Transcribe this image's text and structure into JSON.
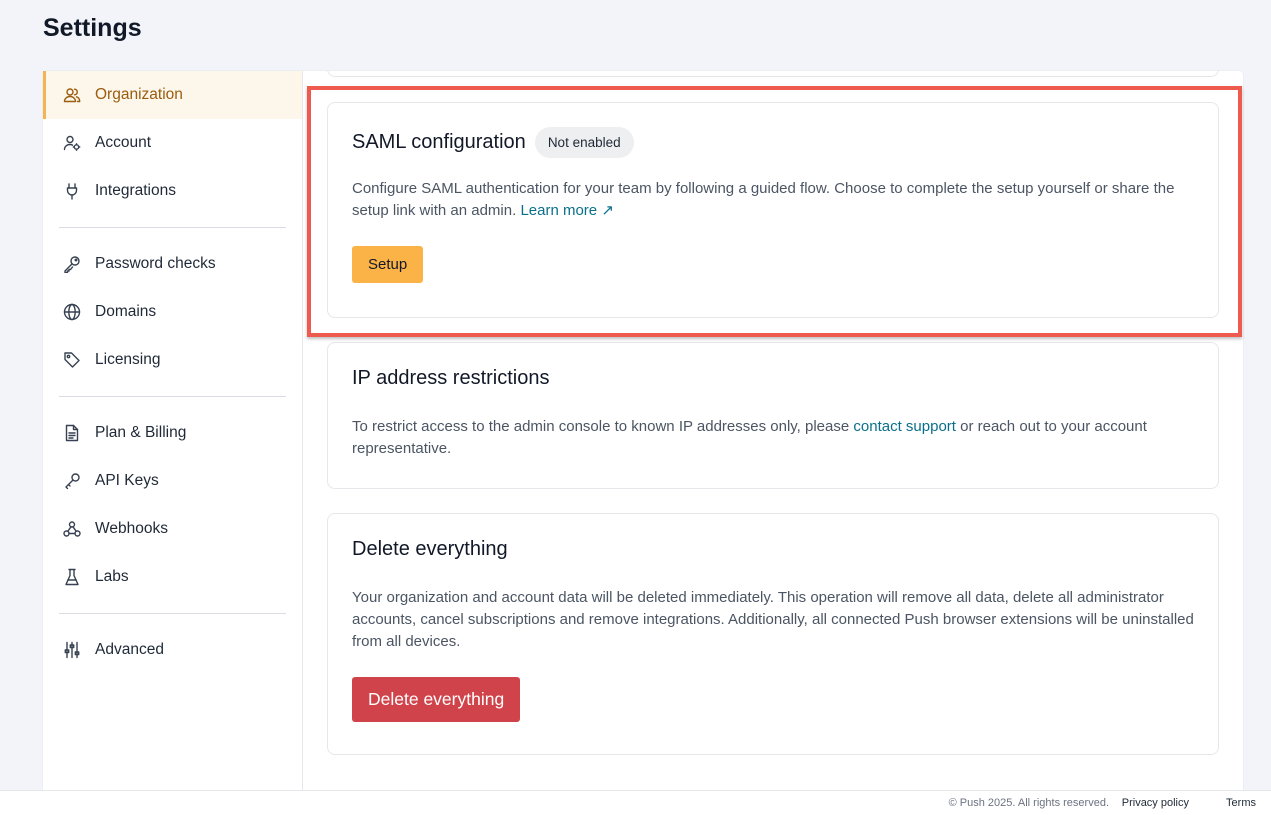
{
  "page": {
    "title": "Settings"
  },
  "sidebar": {
    "groups": [
      [
        {
          "label": "Organization",
          "icon": "users-icon",
          "active": true
        },
        {
          "label": "Account",
          "icon": "user-gear-icon"
        },
        {
          "label": "Integrations",
          "icon": "plug-icon"
        }
      ],
      [
        {
          "label": "Password checks",
          "icon": "key-icon"
        },
        {
          "label": "Domains",
          "icon": "globe-icon"
        },
        {
          "label": "Licensing",
          "icon": "tag-icon"
        }
      ],
      [
        {
          "label": "Plan & Billing",
          "icon": "document-icon"
        },
        {
          "label": "API Keys",
          "icon": "api-key-icon"
        },
        {
          "label": "Webhooks",
          "icon": "webhook-icon"
        },
        {
          "label": "Labs",
          "icon": "flask-icon"
        }
      ],
      [
        {
          "label": "Advanced",
          "icon": "sliders-icon"
        }
      ]
    ]
  },
  "saml": {
    "title": "SAML configuration",
    "badge": "Not enabled",
    "description": "Configure SAML authentication for your team by following a guided flow. Choose to complete the setup yourself or share the setup link with an admin.",
    "learn_more": "Learn more",
    "setup_label": "Setup"
  },
  "ip": {
    "title": "IP address restrictions",
    "description_before": "To restrict access to the admin console to known IP addresses only, please",
    "contact_link": "contact support",
    "description_after": "or reach out to your account representative."
  },
  "delete": {
    "title": "Delete everything",
    "description": "Your organization and account data will be deleted immediately. This operation will remove all data, delete all administrator accounts, cancel subscriptions and remove integrations. Additionally, all connected Push browser extensions will be uninstalled from all devices.",
    "button_label": "Delete everything"
  },
  "footer": {
    "copyright": "© Push 2025. All rights reserved.",
    "privacy": "Privacy policy",
    "terms": "Terms"
  },
  "colors": {
    "accent": "#fbb347",
    "danger": "#d1434a",
    "link": "#0b6f8b",
    "highlight": "#ee5a4e"
  }
}
